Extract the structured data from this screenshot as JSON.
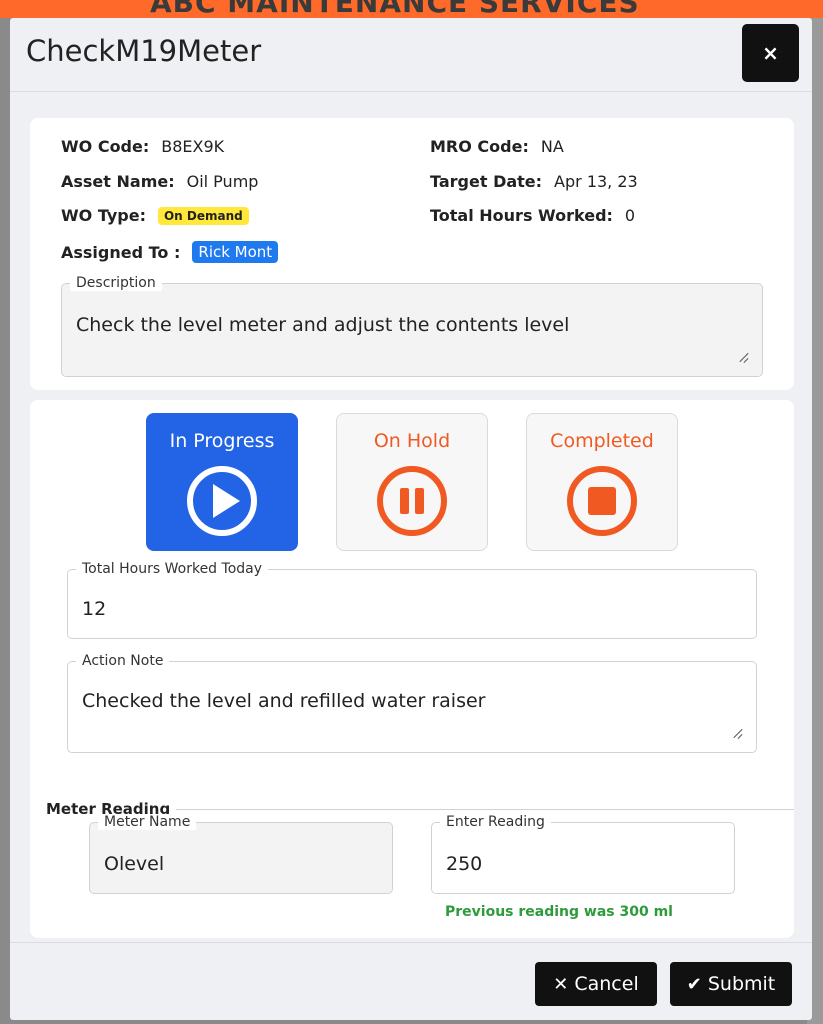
{
  "background": {
    "page_title": "ABC MAINTENANCE SERVICES"
  },
  "modal": {
    "title": "CheckM19Meter",
    "close_label": "×"
  },
  "info": {
    "wo_code_label": "WO Code:",
    "wo_code": "B8EX9K",
    "mro_code_label": "MRO Code:",
    "mro_code": "NA",
    "asset_name_label": "Asset Name:",
    "asset_name": "Oil Pump",
    "target_date_label": "Target Date:",
    "target_date": "Apr 13, 23",
    "wo_type_label": "WO Type:",
    "wo_type": "On Demand",
    "total_hours_label": "Total Hours Worked:",
    "total_hours": "0",
    "assigned_to_label": "Assigned To :",
    "assigned_to": "Rick Mont",
    "description_label": "Description",
    "description": "Check the level meter and adjust the contents level"
  },
  "status": {
    "in_progress_label": "In Progress",
    "on_hold_label": "On Hold",
    "completed_label": "Completed",
    "active": "in_progress",
    "active_color": "#2364e6",
    "inactive_color": "#f05a22"
  },
  "work": {
    "hours_today_label": "Total Hours Worked Today",
    "hours_today": "12",
    "action_note_label": "Action Note",
    "action_note": "Checked the level and refilled water raiser"
  },
  "meter": {
    "section_label": "Meter Reading",
    "meter_name_label": "Meter Name",
    "meter_name": "Olevel",
    "reading_label": "Enter Reading",
    "reading": "250",
    "previous_hint": "Previous reading was 300 ml"
  },
  "footer": {
    "cancel_label": "Cancel",
    "submit_label": "Submit"
  }
}
